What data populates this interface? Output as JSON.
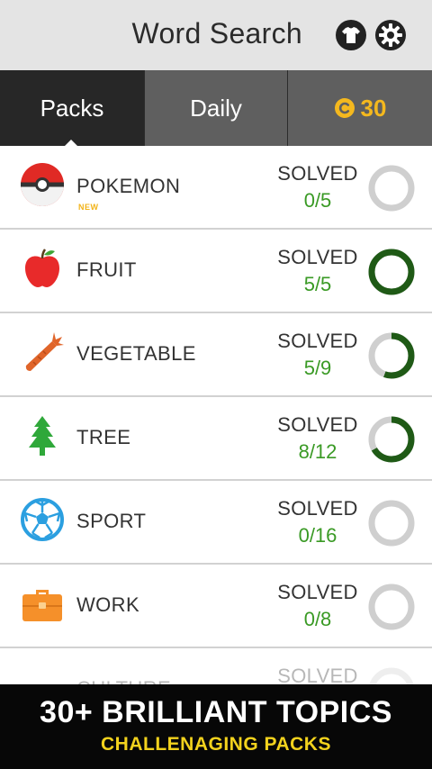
{
  "header": {
    "title": "Word Search",
    "shirt_icon": "tshirt-icon",
    "settings_icon": "gear-icon"
  },
  "tabs": {
    "packs": "Packs",
    "daily": "Daily",
    "coins": "30",
    "coin_icon": "coin-icon"
  },
  "packs": [
    {
      "name": "POKEMON",
      "badge": "NEW",
      "solved_label": "SOLVED",
      "count": "0/5",
      "progress": 0,
      "icon": "pokeball-icon"
    },
    {
      "name": "FRUIT",
      "badge": "",
      "solved_label": "SOLVED",
      "count": "5/5",
      "progress": 1,
      "icon": "apple-icon"
    },
    {
      "name": "VEGETABLE",
      "badge": "",
      "solved_label": "SOLVED",
      "count": "5/9",
      "progress": 0.556,
      "icon": "carrot-icon"
    },
    {
      "name": "TREE",
      "badge": "",
      "solved_label": "SOLVED",
      "count": "8/12",
      "progress": 0.667,
      "icon": "tree-icon"
    },
    {
      "name": "SPORT",
      "badge": "",
      "solved_label": "SOLVED",
      "count": "0/16",
      "progress": 0,
      "icon": "soccer-ball-icon"
    },
    {
      "name": "WORK",
      "badge": "",
      "solved_label": "SOLVED",
      "count": "0/8",
      "progress": 0,
      "icon": "briefcase-icon"
    },
    {
      "name": "CULTURE",
      "badge": "",
      "solved_label": "SOLVED",
      "count": "",
      "progress": 0,
      "icon": "culture-icon"
    }
  ],
  "banner": {
    "title": "30+ BRILLIANT TOPICS",
    "subtitle": "CHALLENAGING PACKS"
  },
  "colors": {
    "ring_track": "#cfcfcf",
    "ring_fill": "#1f5a16",
    "count_green": "#3a9a25",
    "coin_gold": "#f4b81e",
    "new_badge": "#f2b318"
  }
}
